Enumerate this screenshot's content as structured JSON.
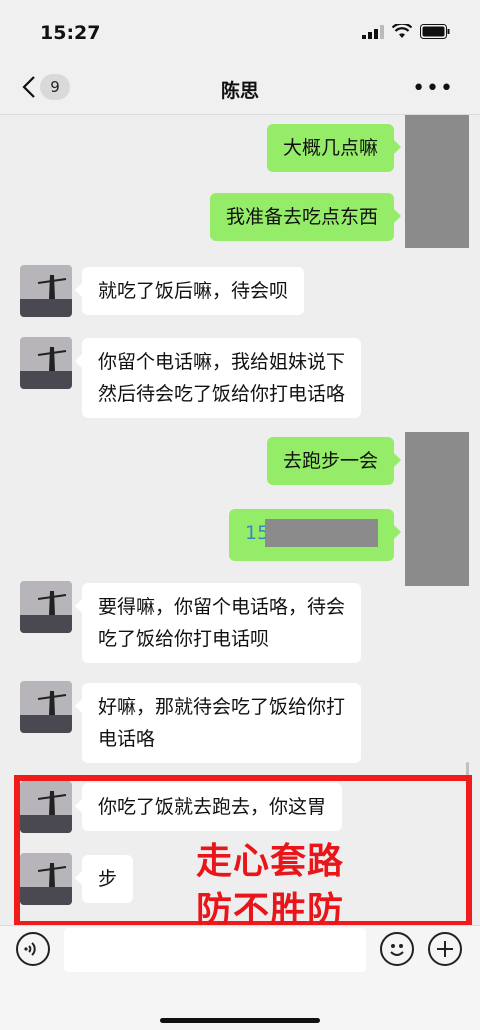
{
  "status": {
    "time": "15:27"
  },
  "nav": {
    "back_badge": "9",
    "title": "陈思",
    "more": "•••"
  },
  "messages": [
    {
      "side": "right",
      "text": "大概几点嘛"
    },
    {
      "side": "right",
      "text": "我准备去吃点东西"
    },
    {
      "side": "left",
      "text": "就吃了饭后嘛，待会呗"
    },
    {
      "side": "left",
      "line1": "你留个电话嘛，我给姐妹说下",
      "line2": "然后待会吃了饭给你打电话咯"
    },
    {
      "side": "right",
      "text": "去跑步一会"
    },
    {
      "side": "right",
      "text": "15"
    },
    {
      "side": "left",
      "line1": "要得嘛，你留个电话咯，待会",
      "line2": "吃了饭给你打电话呗"
    },
    {
      "side": "left",
      "line1": "好嘛，那就待会吃了饭给你打",
      "line2": "电话咯"
    },
    {
      "side": "left",
      "text": "你吃了饭就去跑去，你这胃"
    },
    {
      "side": "left",
      "text": "步"
    }
  ],
  "overlay": {
    "line1": "走心套路",
    "line2": "防不胜防"
  },
  "colors": {
    "right_bubble": "#95ec69",
    "highlight": "#e8161a"
  }
}
